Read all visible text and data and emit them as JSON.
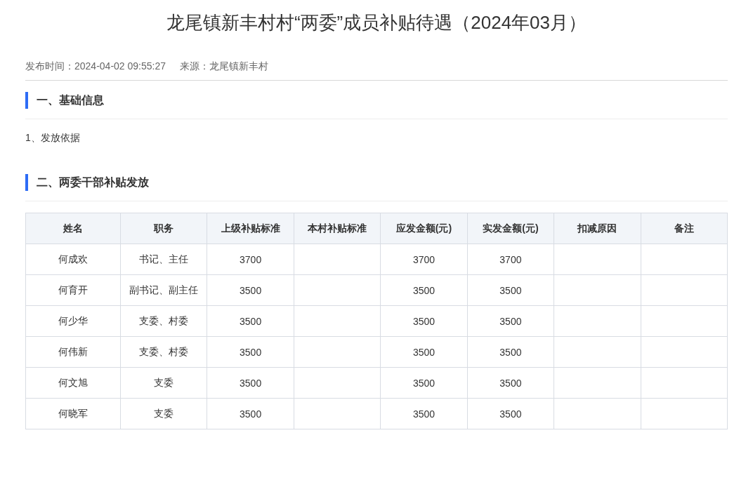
{
  "title": "龙尾镇新丰村村“两委”成员补贴待遇（2024年03月）",
  "meta": {
    "published": "发布时间：2024-04-02 09:55:27",
    "source": "来源：龙尾镇新丰村"
  },
  "sections": [
    {
      "heading": "一、基础信息",
      "paragraphs": [
        "1、发放依据"
      ]
    },
    {
      "heading": "二、两委干部补贴发放"
    }
  ],
  "table": {
    "columns": [
      "姓名",
      "职务",
      "上级补贴标准",
      "本村补贴标准",
      "应发金额(元)",
      "实发金额(元)",
      "扣减原因",
      "备注"
    ],
    "rows": [
      {
        "name": "何成欢",
        "post": "书记、主任",
        "upper_standard": "3700",
        "payable": "3700",
        "paid": "3700"
      },
      {
        "name": "何育开",
        "post": "副书记、副主任",
        "upper_standard": "3500",
        "payable": "3500",
        "paid": "3500"
      },
      {
        "name": "何少华",
        "post": "支委、村委",
        "upper_standard": "3500",
        "payable": "3500",
        "paid": "3500"
      },
      {
        "name": "何伟新",
        "post": "支委、村委",
        "upper_standard": "3500",
        "payable": "3500",
        "paid": "3500"
      },
      {
        "name": "何文旭",
        "post": "支委",
        "upper_standard": "3500",
        "payable": "3500",
        "paid": "3500"
      },
      {
        "name": "何晓军",
        "post": "支委",
        "upper_standard": "3500",
        "payable": "3500",
        "paid": "3500"
      }
    ]
  }
}
